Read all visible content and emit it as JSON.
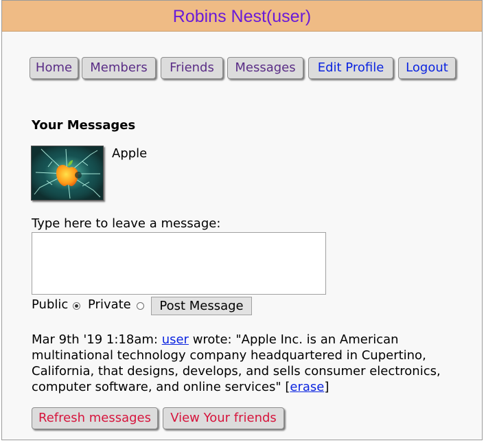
{
  "header": {
    "title": "Robins Nest(user)"
  },
  "nav": {
    "home": "Home",
    "members": "Members",
    "friends": "Friends",
    "messages": "Messages",
    "edit_profile": "Edit Profile",
    "logout": "Logout"
  },
  "messages_section": {
    "title": "Your Messages",
    "profile_name": "Apple",
    "prompt": "Type here to leave a message:",
    "textarea_value": ""
  },
  "visibility": {
    "public_label": "Public",
    "private_label": "Private",
    "selected": "Public"
  },
  "post_button": "Post Message",
  "message": {
    "timestamp": "Mar 9th '19 1:18am:",
    "author": "user",
    "verb": "wrote:",
    "text": "\"Apple Inc. is an American multinational technology company headquartered in Cupertino, California, that designs, develops, and sells consumer electronics, computer software, and online services\"",
    "erase_label": "erase"
  },
  "actions": {
    "refresh": "Refresh messages",
    "view_friends": "View Your friends"
  },
  "colors": {
    "header_bg": "#efbb85",
    "header_text": "#6a1bd8",
    "visited_link": "#5a2d86",
    "link": "#0b24e0",
    "action_link": "#d6143c"
  }
}
